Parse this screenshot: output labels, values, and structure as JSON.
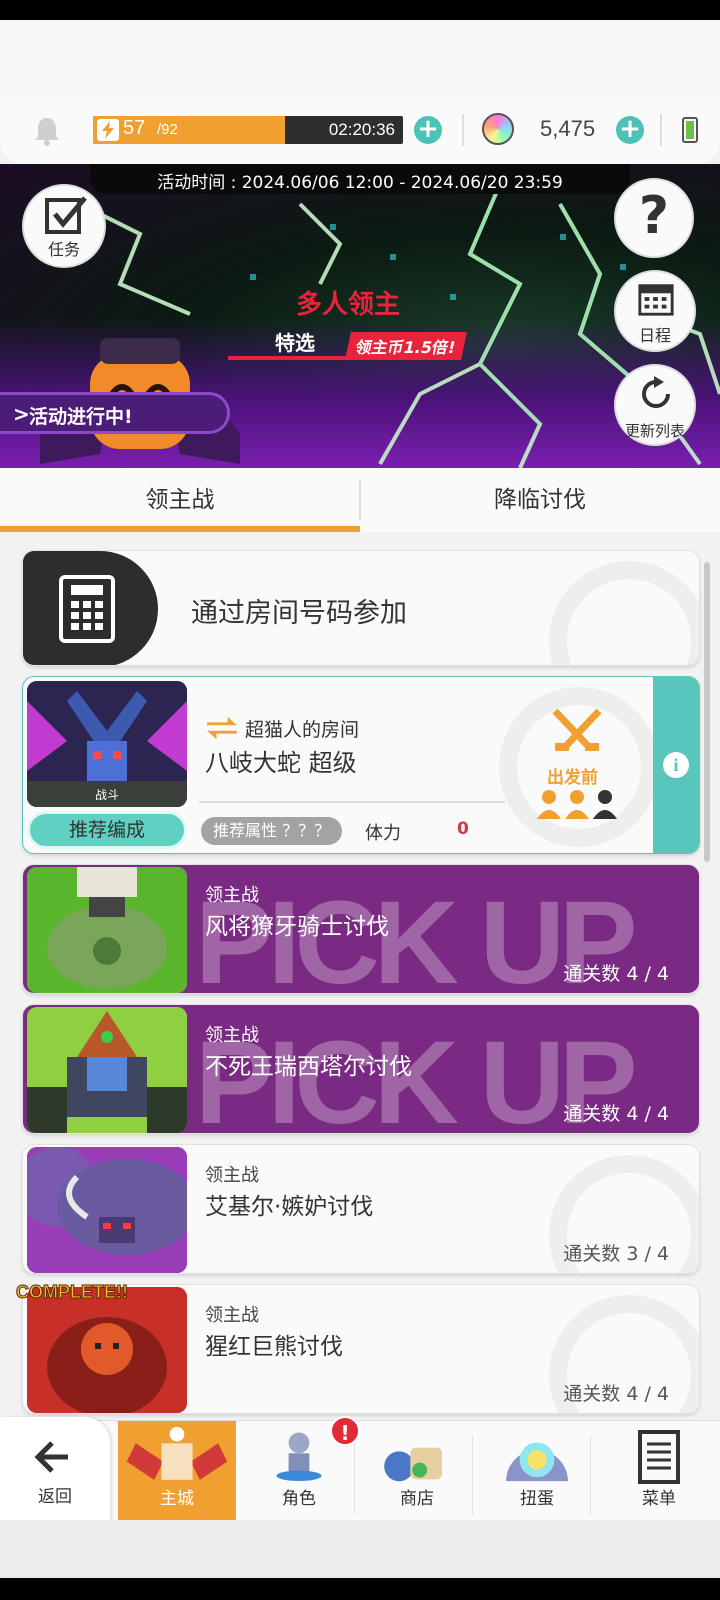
{
  "status_bar": {
    "stamina_current": "57",
    "stamina_max": "/92",
    "stamina_fraction": 0.62,
    "stamina_timer": "02:20:36",
    "gems": "5,475",
    "colors": {
      "stamina": "#f0a030",
      "plus": "#4cc2b4"
    }
  },
  "banner": {
    "event_time": "活动时间 : 2024.06/06 12:00 - 2024.06/20 23:59",
    "title": "多人领主",
    "subtitle": "特选",
    "bonus": "领主币1.5倍!",
    "event_status": "活动进行中!",
    "buttons": {
      "tasks": "任务",
      "help": "?",
      "schedule": "日程",
      "refresh": "更新列表"
    }
  },
  "tabs": [
    {
      "label": "领主战",
      "active": true
    },
    {
      "label": "降临讨伐",
      "active": false
    }
  ],
  "room_code": {
    "label": "通过房间号码参加"
  },
  "room_card": {
    "host": "超猫人的房间",
    "boss": "八岐大蛇 超级",
    "thumb_caption": "战斗",
    "recommend_button": "推荐编成",
    "recommend_attr_label": "推荐属性 ？？？",
    "stamina_label": "体力",
    "stamina_value": "0",
    "state": "出发前",
    "players_filled": 2,
    "players_total": 3
  },
  "raid_list": [
    {
      "kind": "领主战",
      "name": "风将獠牙骑士讨伐",
      "clear": "通关数 4 / 4",
      "pickup": true,
      "pickup_text": "PICK UP"
    },
    {
      "kind": "领主战",
      "name": "不死王瑞西塔尔讨伐",
      "clear": "通关数 4 / 4",
      "pickup": true,
      "pickup_text": "PICK UP"
    },
    {
      "kind": "领主战",
      "name": "艾基尔·嫉妒讨伐",
      "clear": "通关数 3 / 4",
      "pickup": false
    },
    {
      "kind": "领主战",
      "name": "猩红巨熊讨伐",
      "clear": "通关数 4 / 4",
      "pickup": false,
      "complete_label": "COMPLETE!!"
    }
  ],
  "bottom_nav": [
    {
      "label": "返回",
      "icon": "back-arrow-icon"
    },
    {
      "label": "主城",
      "icon": "castle-icon",
      "active": true
    },
    {
      "label": "角色",
      "icon": "character-icon",
      "badge": "!"
    },
    {
      "label": "商店",
      "icon": "shop-bag-icon"
    },
    {
      "label": "扭蛋",
      "icon": "gacha-icon"
    },
    {
      "label": "菜单",
      "icon": "menu-list-icon"
    }
  ]
}
